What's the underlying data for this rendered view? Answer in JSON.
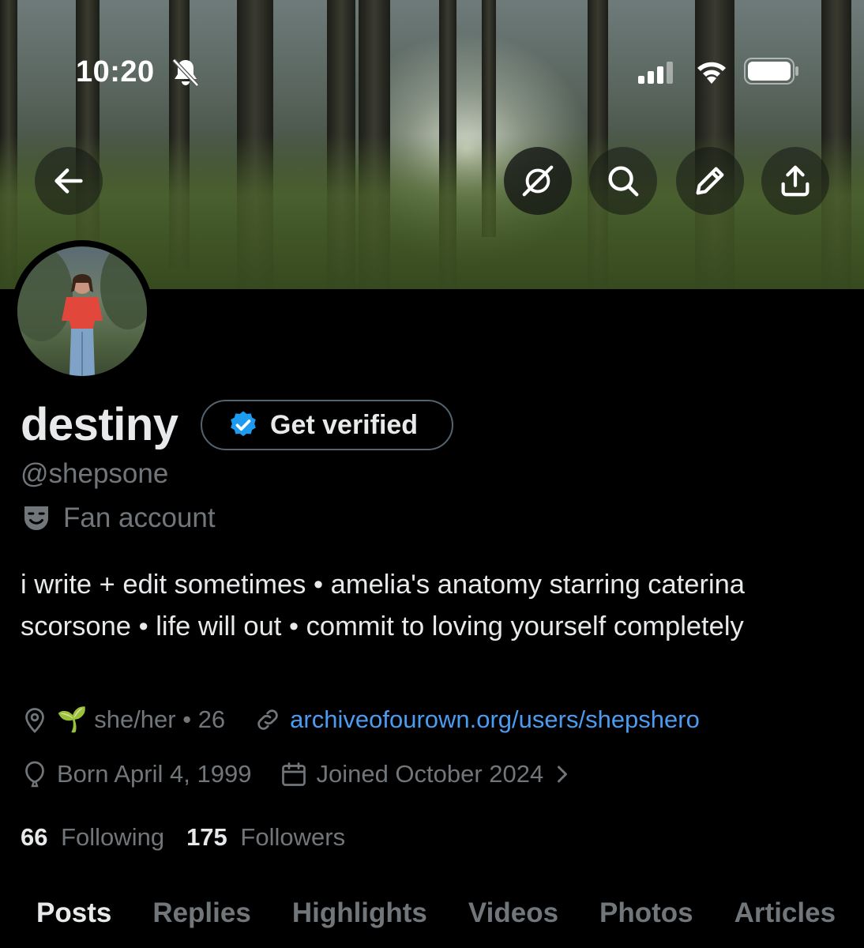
{
  "status_bar": {
    "time": "10:20"
  },
  "header_icons": [
    "back-arrow-icon",
    "grok-icon",
    "search-icon",
    "pencil-icon",
    "share-icon"
  ],
  "profile": {
    "name": "destiny",
    "verify_label": "Get verified",
    "handle": "@shepsone",
    "category": "Fan account",
    "bio": "i write + edit sometimes • amelia's anatomy starring caterina scorsone • life will out • commit to loving yourself completely",
    "location": "🌱 she/her • 26",
    "website": "archiveofourown.org/users/shepshero",
    "birthday": "Born April 4, 1999",
    "joined": "Joined October 2024",
    "following_count": "66",
    "following_label": "Following",
    "followers_count": "175",
    "followers_label": "Followers"
  },
  "tabs": [
    {
      "label": "Posts"
    },
    {
      "label": "Replies"
    },
    {
      "label": "Highlights"
    },
    {
      "label": "Videos"
    },
    {
      "label": "Photos"
    },
    {
      "label": "Articles"
    }
  ],
  "colors": {
    "background": "#000000",
    "text_primary": "#e7e9ea",
    "text_secondary": "#71767b",
    "link": "#4b9cf0",
    "verified_badge": "#1d9bf0"
  }
}
